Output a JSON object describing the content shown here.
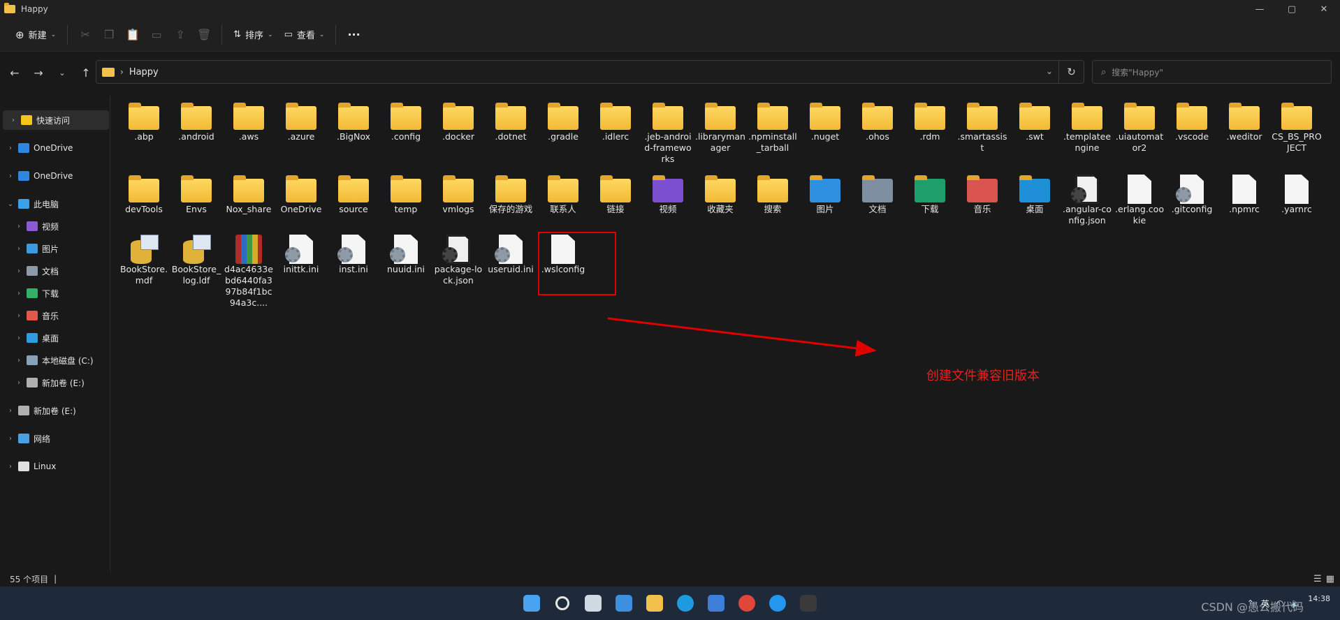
{
  "window": {
    "title": "Happy"
  },
  "window_controls": {
    "minimize": "—",
    "maximize": "▢",
    "close": "✕"
  },
  "commandbar": {
    "new_label": "新建",
    "sort_label": "排序",
    "view_label": "查看",
    "more_label": "···"
  },
  "address": {
    "path": "Happy",
    "separator": "›"
  },
  "search": {
    "placeholder": "搜索\"Happy\""
  },
  "sidebar": {
    "items": [
      {
        "label": "快速访问",
        "icon": "star-icon",
        "color": "#f5c518"
      },
      {
        "label": "OneDrive",
        "icon": "cloud-icon",
        "color": "#2f86e0"
      },
      {
        "label": "OneDrive",
        "icon": "cloud-icon",
        "color": "#2f86e0"
      },
      {
        "label": "此电脑",
        "icon": "pc-icon",
        "color": "#3aa0e8"
      },
      {
        "label": "视频",
        "icon": "video-icon",
        "color": "#8a5ad6"
      },
      {
        "label": "图片",
        "icon": "picture-icon",
        "color": "#3c9be0"
      },
      {
        "label": "文档",
        "icon": "document-icon",
        "color": "#8c9aa8"
      },
      {
        "label": "下载",
        "icon": "download-icon",
        "color": "#30b06a"
      },
      {
        "label": "音乐",
        "icon": "music-icon",
        "color": "#e4584c"
      },
      {
        "label": "桌面",
        "icon": "desktop-icon",
        "color": "#2f9be0"
      },
      {
        "label": "本地磁盘 (C:)",
        "icon": "disk-icon",
        "color": "#8aa0b8"
      },
      {
        "label": "新加卷 (E:)",
        "icon": "drive-icon",
        "color": "#b0b0b0"
      },
      {
        "label": "新加卷 (E:)",
        "icon": "drive-icon",
        "color": "#b0b0b0"
      },
      {
        "label": "网络",
        "icon": "network-icon",
        "color": "#4aa0e0"
      },
      {
        "label": "Linux",
        "icon": "linux-icon",
        "color": "#e0e0e0"
      }
    ]
  },
  "files": [
    {
      "name": ".abp",
      "type": "folder"
    },
    {
      "name": ".android",
      "type": "folder"
    },
    {
      "name": ".aws",
      "type": "folder"
    },
    {
      "name": ".azure",
      "type": "folder"
    },
    {
      "name": ".BigNox",
      "type": "folder"
    },
    {
      "name": ".config",
      "type": "folder"
    },
    {
      "name": ".docker",
      "type": "folder"
    },
    {
      "name": ".dotnet",
      "type": "folder"
    },
    {
      "name": ".gradle",
      "type": "folder"
    },
    {
      "name": ".idlerc",
      "type": "folder"
    },
    {
      "name": ".jeb-android-frameworks",
      "type": "folder"
    },
    {
      "name": ".librarymanager",
      "type": "folder"
    },
    {
      "name": ".npminstall_tarball",
      "type": "folder"
    },
    {
      "name": ".nuget",
      "type": "folder"
    },
    {
      "name": ".ohos",
      "type": "folder"
    },
    {
      "name": ".rdm",
      "type": "folder"
    },
    {
      "name": ".smartassist",
      "type": "folder"
    },
    {
      "name": ".swt",
      "type": "folder"
    },
    {
      "name": ".templateengine",
      "type": "folder"
    },
    {
      "name": ".uiautomator2",
      "type": "folder"
    },
    {
      "name": ".vscode",
      "type": "folder"
    },
    {
      "name": ".weditor",
      "type": "folder"
    },
    {
      "name": "CS_BS_PROJECT",
      "type": "folder"
    },
    {
      "name": "devTools",
      "type": "folder"
    },
    {
      "name": "Envs",
      "type": "folder"
    },
    {
      "name": "Nox_share",
      "type": "folder"
    },
    {
      "name": "OneDrive",
      "type": "folder"
    },
    {
      "name": "source",
      "type": "folder"
    },
    {
      "name": "temp",
      "type": "folder"
    },
    {
      "name": "vmlogs",
      "type": "folder"
    },
    {
      "name": "保存的游戏",
      "type": "folder"
    },
    {
      "name": "联系人",
      "type": "folder"
    },
    {
      "name": "链接",
      "type": "folder"
    },
    {
      "name": "视频",
      "type": "video-folder"
    },
    {
      "name": "收藏夹",
      "type": "folder"
    },
    {
      "name": "搜索",
      "type": "folder"
    },
    {
      "name": "图片",
      "type": "picture-folder"
    },
    {
      "name": "文档",
      "type": "document-folder"
    },
    {
      "name": "下载",
      "type": "download-folder"
    },
    {
      "name": "音乐",
      "type": "music-folder"
    },
    {
      "name": "桌面",
      "type": "desktop-folder"
    },
    {
      "name": ".angular-config.json",
      "type": "json"
    },
    {
      "name": ".erlang.cookie",
      "type": "file"
    },
    {
      "name": ".gitconfig",
      "type": "config"
    },
    {
      "name": ".npmrc",
      "type": "file"
    },
    {
      "name": ".yarnrc",
      "type": "file"
    },
    {
      "name": "BookStore.mdf",
      "type": "db"
    },
    {
      "name": "BookStore_log.ldf",
      "type": "db"
    },
    {
      "name": "d4ac4633ebd6440fa397b84f1bc94a3c....",
      "type": "archive"
    },
    {
      "name": "inittk.ini",
      "type": "config"
    },
    {
      "name": "inst.ini",
      "type": "config"
    },
    {
      "name": "nuuid.ini",
      "type": "config"
    },
    {
      "name": "package-lock.json",
      "type": "json"
    },
    {
      "name": "useruid.ini",
      "type": "config"
    },
    {
      "name": ".wslconfig",
      "type": "file"
    }
  ],
  "annotation": {
    "text": "创建文件兼容旧版本",
    "color": "#e82020"
  },
  "status": {
    "count": "55 个项目",
    "sep": "|"
  },
  "taskbar": {
    "apps": [
      "start-icon",
      "search-icon",
      "taskview-icon",
      "widgets-icon",
      "explorer-icon",
      "edge-icon",
      "store-icon",
      "chrome-icon",
      "docker-icon",
      "terminal-icon"
    ],
    "clock_time": "14:38",
    "tray_lang": "英",
    "watermark": "CSDN @愚公搬代码"
  }
}
